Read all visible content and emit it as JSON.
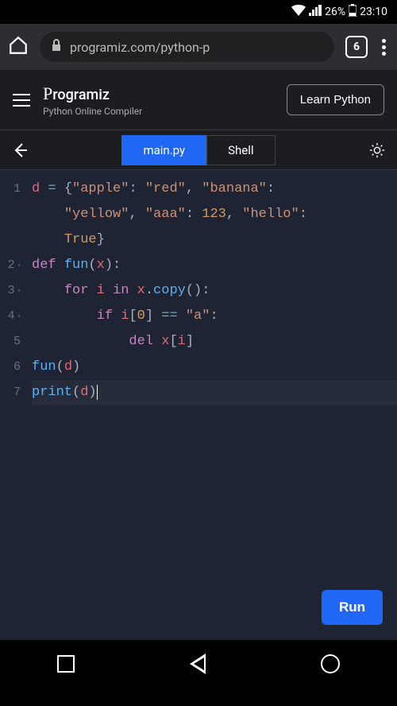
{
  "status": {
    "battery": "26%",
    "time": "23:10"
  },
  "browser": {
    "url": "programiz.com/python-p",
    "tab_count": "6"
  },
  "site": {
    "brand": "rogramiz",
    "subtitle": "Python Online Compiler",
    "learn_label": "Learn Python"
  },
  "tabs": {
    "main": "main.py",
    "shell": "Shell"
  },
  "code": {
    "lines": [
      "1",
      "2",
      "3",
      "4",
      "5",
      "6",
      "7"
    ]
  },
  "run_label": "Run"
}
